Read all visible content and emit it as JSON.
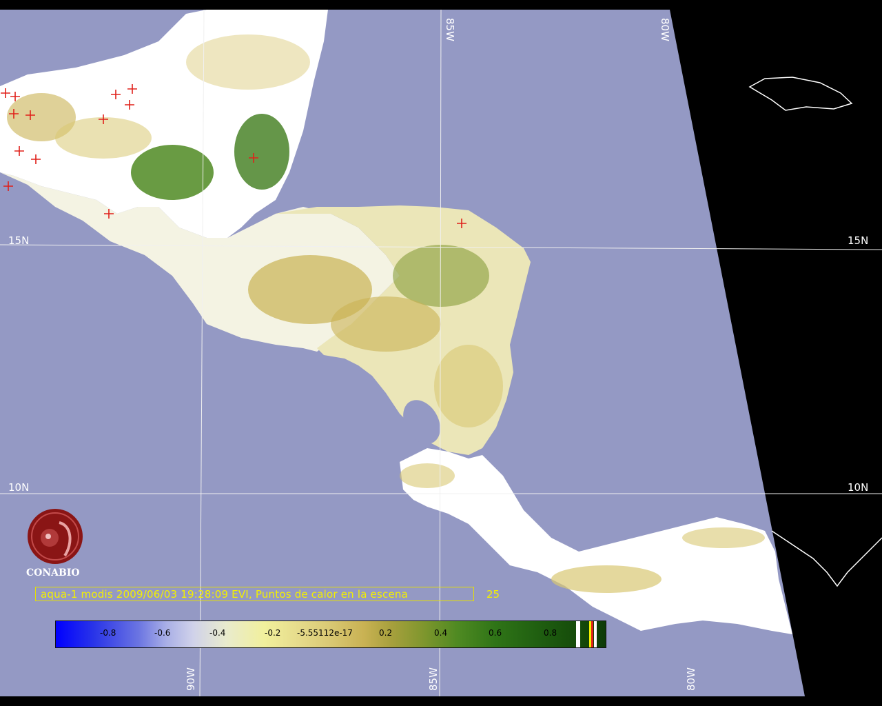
{
  "grid_labels": {
    "lon_top": [
      "85W",
      "80W"
    ],
    "lon_bottom": [
      "90W",
      "85W",
      "80W"
    ],
    "lat_left": [
      "15N",
      "10N"
    ],
    "lat_right": [
      "15N",
      "10N"
    ]
  },
  "logo": {
    "text": "CONABIO"
  },
  "caption": {
    "text": "aqua-1 modis 2009/06/03 19:28:09 EVI, Puntos de calor en la escena",
    "count": "25"
  },
  "colorbar": {
    "labels": [
      "-0.8",
      "-0.6",
      "-0.4",
      "-0.2",
      "-5.55112e-17",
      "0.2",
      "0.4",
      "0.6",
      "0.8"
    ]
  },
  "colors": {
    "ocean": "#9499c4",
    "land_no_data": "#ffffff",
    "outside_swath": "#000000",
    "caption": "#f3f000",
    "hotspot": "#e0201a",
    "logo": "#8a1515"
  }
}
